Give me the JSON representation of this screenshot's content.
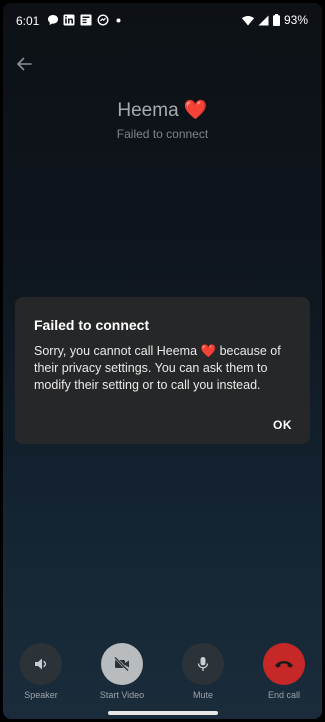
{
  "status_bar": {
    "time": "6:01",
    "battery": "93%"
  },
  "contact": {
    "name": "Heema",
    "heart": "❤️",
    "call_status": "Failed to connect"
  },
  "dialog": {
    "title": "Failed to connect",
    "body_prefix": "Sorry, you cannot call Heema ",
    "body_heart": "❤️",
    "body_suffix": " because of their privacy settings. You can ask them to modify their setting or to call you instead.",
    "ok_label": "OK"
  },
  "controls": [
    {
      "label": "Speaker",
      "icon": "speaker-icon"
    },
    {
      "label": "Start Video",
      "icon": "video-off-icon"
    },
    {
      "label": "Mute",
      "icon": "mic-icon"
    },
    {
      "label": "End call",
      "icon": "end-call-icon"
    }
  ],
  "colors": {
    "end_call": "#c62828",
    "dialog_bg": "#262728",
    "heart": "#d32f2f"
  }
}
